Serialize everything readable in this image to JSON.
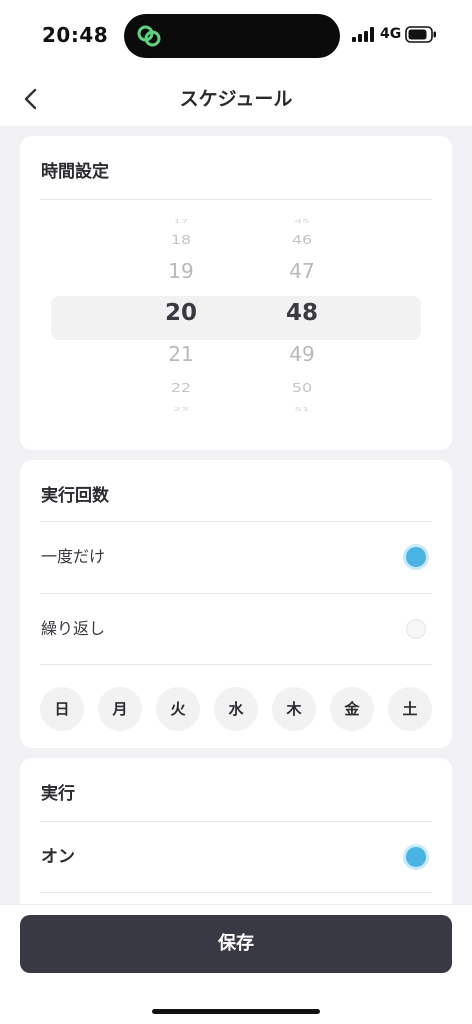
{
  "status_bar": {
    "time": "20:48",
    "network": "4G",
    "signal_icon": "cellular-signal-icon",
    "battery_icon": "battery-icon",
    "island_app_icon": "linked-rings-app-icon",
    "island_icon_color": "#5fd07f"
  },
  "nav": {
    "title": "スケジュール",
    "back_icon": "chevron-left-icon"
  },
  "time_settings": {
    "title": "時間設定",
    "hours": [
      "17",
      "18",
      "19",
      "20",
      "21",
      "22",
      "23"
    ],
    "minutes": [
      "45",
      "46",
      "47",
      "48",
      "49",
      "50",
      "51"
    ],
    "selected_hour": "20",
    "selected_minute": "48"
  },
  "run_count": {
    "title": "実行回数",
    "options": [
      {
        "label": "一度だけ",
        "selected": true
      },
      {
        "label": "繰り返し",
        "selected": false
      }
    ],
    "weekdays": [
      "日",
      "月",
      "火",
      "水",
      "木",
      "金",
      "土"
    ]
  },
  "execution": {
    "title": "実行",
    "options": [
      {
        "label": "オン",
        "selected": true
      }
    ]
  },
  "footer": {
    "save_label": "保存"
  },
  "colors": {
    "accent": "#4ab3e3",
    "button_bg": "#383942",
    "page_bg": "#f2f2f4"
  }
}
